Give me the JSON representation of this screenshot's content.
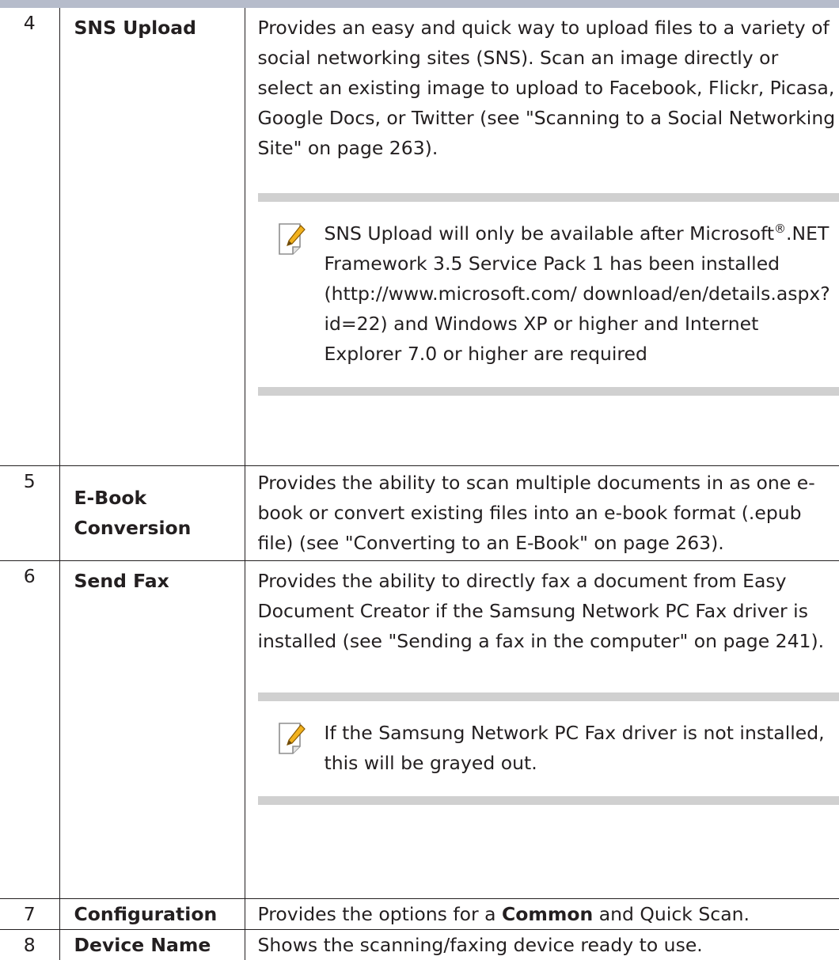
{
  "rows": [
    {
      "num": "4",
      "name": "SNS Upload",
      "desc": "Provides an easy and quick way to upload files to a variety of social networking sites (SNS). Scan an image directly or select an existing image to upload to Facebook, Flickr, Picasa, Google Docs, or Twitter (see \"Scanning to a Social Networking Site\" on page 263).",
      "note": {
        "before": "SNS Upload will only be available after Microsoft",
        "sup": "®",
        "after": ".NET Framework 3.5 Service Pack 1 has been installed (http://www.microsoft.com/ download/en/details.aspx?id=22) and Windows XP or higher and Internet Explorer 7.0 or higher are required"
      }
    },
    {
      "num": "5",
      "name": "E-Book Conversion",
      "desc": "Provides the ability to scan multiple documents in as one e-book or convert existing files into an e-book format (.epub file) (see \"Converting to an E-Book\" on page 263)."
    },
    {
      "num": "6",
      "name": "Send Fax",
      "desc": "Provides the ability to directly fax a document from Easy Document Creator if the Samsung Network PC Fax driver is installed (see \"Sending a fax in the computer\" on page 241).",
      "note": {
        "text": "If the Samsung Network PC Fax driver is not installed, this will be grayed out."
      }
    },
    {
      "num": "7",
      "name": "Configuration",
      "desc": {
        "before": "Provides the options for a ",
        "bold": "Common",
        "after": " and Quick Scan."
      }
    },
    {
      "num": "8",
      "name": "Device Name",
      "desc": "Shows the scanning/faxing device ready to use."
    }
  ],
  "icons": {
    "note": "note-pencil-icon"
  },
  "colors": {
    "top_bar": "#b6bccb",
    "note_band": "#d0d0d0",
    "text": "#231f20",
    "pencil": "#f2b21e"
  }
}
